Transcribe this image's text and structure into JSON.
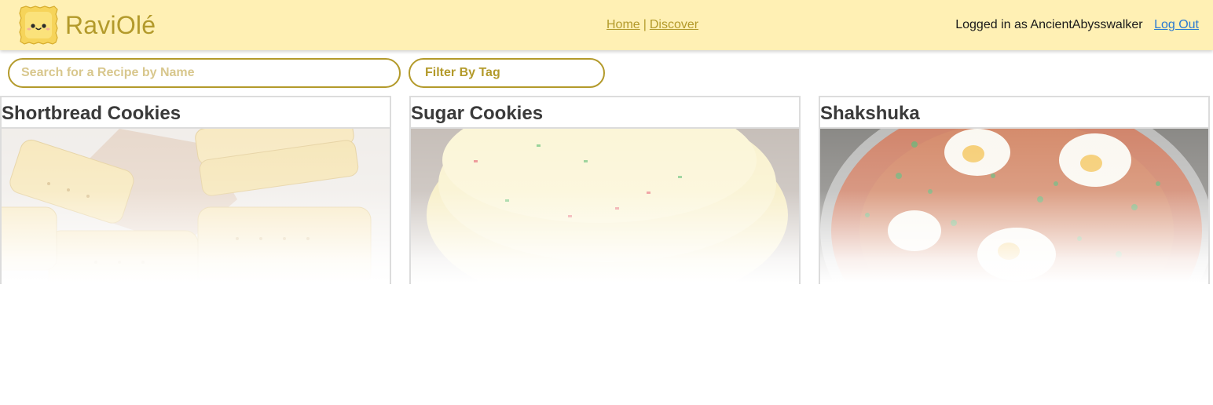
{
  "app": {
    "title": "RaviOlé",
    "logo_icon": "ravioli-face-icon"
  },
  "nav": {
    "home": "Home",
    "separator": "|",
    "discover": "Discover"
  },
  "user": {
    "status": "Logged in as AncientAbysswalker",
    "logout": "Log Out"
  },
  "search": {
    "placeholder": "Search for a Recipe by Name",
    "value": ""
  },
  "filter": {
    "label": "Filter By Tag"
  },
  "recipes": [
    {
      "title": "Shortbread Cookies",
      "image": "shortbread-cookies-photo"
    },
    {
      "title": "Sugar Cookies",
      "image": "sugar-cookies-photo"
    },
    {
      "title": "Shakshuka",
      "image": "shakshuka-photo"
    }
  ],
  "colors": {
    "header_bg": "#fff0b4",
    "accent": "#b39a2b",
    "link_blue": "#2a7ad2",
    "card_border": "#dcdcdc"
  }
}
